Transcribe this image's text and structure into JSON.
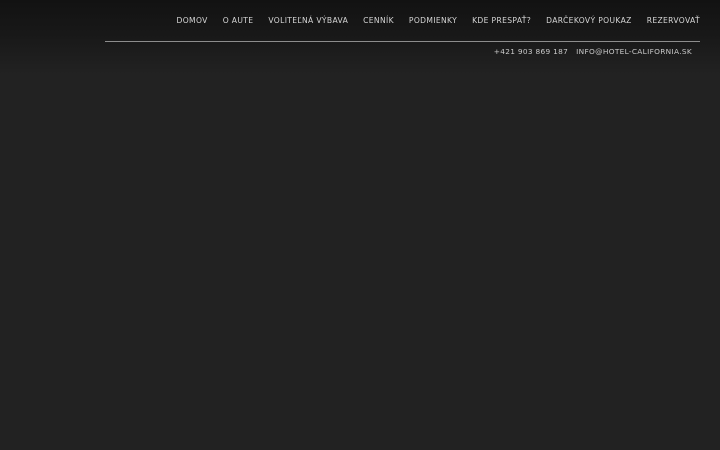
{
  "nav": {
    "items": [
      {
        "label": "DOMOV"
      },
      {
        "label": "O AUTE"
      },
      {
        "label": "VOLITEĽNÁ VÝBAVA"
      },
      {
        "label": "CENNÍK"
      },
      {
        "label": "PODMIENKY"
      },
      {
        "label": "KDE PRESPAŤ?"
      },
      {
        "label": "DARČEKOVÝ POUKAZ"
      },
      {
        "label": "REZERVOVAŤ"
      }
    ]
  },
  "contact": {
    "phone": "+421 903 869 187",
    "email": "INFO@HOTEL-CALIFORNIA.SK"
  },
  "colors": {
    "background": "#222222",
    "header_top": "#121212",
    "nav_text": "#d6d6d6",
    "divider": "#9a9a9a"
  }
}
